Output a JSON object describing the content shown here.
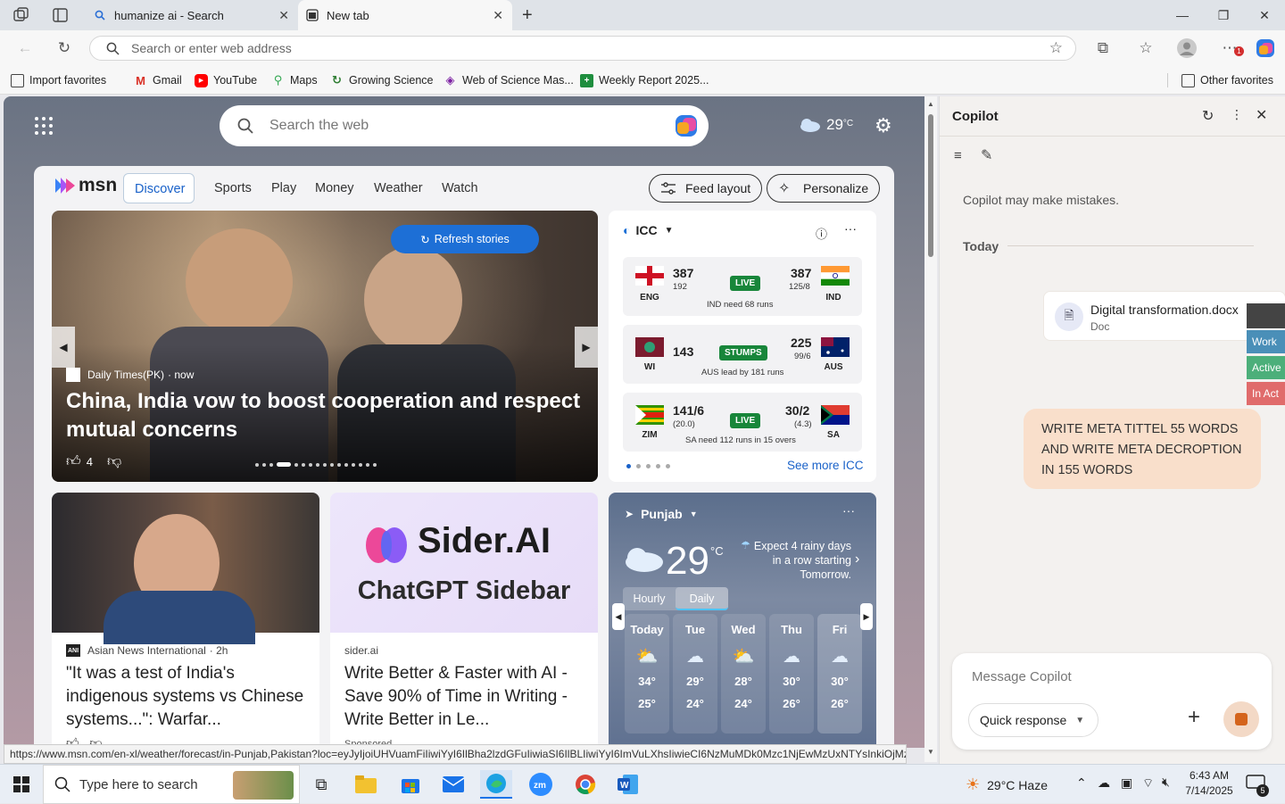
{
  "browser": {
    "tabs": [
      {
        "title": "humanize ai - Search",
        "icon": "search-icon"
      },
      {
        "title": "New tab",
        "icon": "newtab-icon"
      }
    ],
    "address_placeholder": "Search or enter web address",
    "notification_count": "1"
  },
  "bookmarks": [
    {
      "label": "Import favorites"
    },
    {
      "label": "Gmail"
    },
    {
      "label": "YouTube"
    },
    {
      "label": "Maps"
    },
    {
      "label": "Growing Science"
    },
    {
      "label": "Web of Science Mas..."
    },
    {
      "label": "Weekly Report 2025..."
    }
  ],
  "other_favorites": "Other favorites",
  "newtab": {
    "search_placeholder": "Search the web",
    "weather_temp": "29",
    "weather_unit": "°C"
  },
  "msn": {
    "logo_text": "msn",
    "nav": [
      "Discover",
      "Sports",
      "Play",
      "Money",
      "Weather",
      "Watch"
    ],
    "feed_layout": "Feed layout",
    "personalize": "Personalize",
    "hero": {
      "refresh": "Refresh stories",
      "source": "Daily Times(PK)",
      "time": "· now",
      "headline": "China, India vow to boost cooperation and respect mutual concerns",
      "likes": "4"
    },
    "icc": {
      "title": "ICC",
      "matches": [
        {
          "t1": "ENG",
          "t1_score": "387",
          "t1_sub": "192",
          "status": "LIVE",
          "t2": "IND",
          "t2_score": "387",
          "t2_sub": "125/8",
          "note": "IND need 68 runs"
        },
        {
          "t1": "WI",
          "t1_score": "143",
          "t1_sub": "",
          "status": "STUMPS",
          "t2": "AUS",
          "t2_score": "225",
          "t2_sub": "99/6",
          "note": "AUS lead by 181 runs"
        },
        {
          "t1": "ZIM",
          "t1_score": "141/6",
          "t1_sub": "(20.0)",
          "status": "LIVE",
          "t2": "SA",
          "t2_score": "30/2",
          "t2_sub": "(4.3)",
          "note": "SA need 112 runs in 15 overs"
        }
      ],
      "see_more": "See more ICC"
    },
    "news": [
      {
        "source": "Asian News International",
        "time": "· 2h",
        "headline": "\"It was a test of India's indigenous systems vs Chinese systems...\": Warfar..."
      },
      {
        "source": "sider.ai",
        "brand": "Sider.AI",
        "tagline": "ChatGPT Sidebar",
        "headline": "Write Better & Faster with AI - Save 90% of Time in Writing - Write Better in Le...",
        "sponsored": "Sponsored"
      }
    ],
    "weather": {
      "location": "Punjab",
      "temp": "29",
      "unit": "°C",
      "alert": "Expect 4 rainy days in a row starting Tomorrow.",
      "tabs": [
        "Hourly",
        "Daily"
      ],
      "days": [
        {
          "day": "Today",
          "hi": "34°",
          "lo": "25°"
        },
        {
          "day": "Tue",
          "hi": "29°",
          "lo": "24°"
        },
        {
          "day": "Wed",
          "hi": "28°",
          "lo": "24°"
        },
        {
          "day": "Thu",
          "hi": "30°",
          "lo": "26°"
        },
        {
          "day": "Fri",
          "hi": "30°",
          "lo": "26°"
        }
      ]
    }
  },
  "status_url": "https://www.msn.com/en-xl/weather/forecast/in-Punjab,Pakistan?loc=eyJyIjoiUHVuamFiIiwiYyI6IlBha2lzdGFuIiwiaSI6IlBLIiwiYyI6ImVuLXhsIiwieCI6NzMuMDk0Mzc1NjEwMzUxNTYsInkiOjMzLj...",
  "copilot": {
    "title": "Copilot",
    "disclaimer": "Copilot may make mistakes.",
    "today": "Today",
    "doc_name": "Digital transformation.docx",
    "doc_type": "Doc",
    "user_message": "WRITE META TITTEL 55 WORDS AND WRITE META DECROPTION IN 155 WORDS",
    "input_placeholder": "Message Copilot",
    "mode": "Quick response",
    "side_tags": [
      "Work",
      "Active",
      "In Act"
    ]
  },
  "taskbar": {
    "search_placeholder": "Type here to search",
    "weather": "29°C  Haze",
    "time": "6:43 AM",
    "date": "7/14/2025",
    "notif_count": "5"
  }
}
